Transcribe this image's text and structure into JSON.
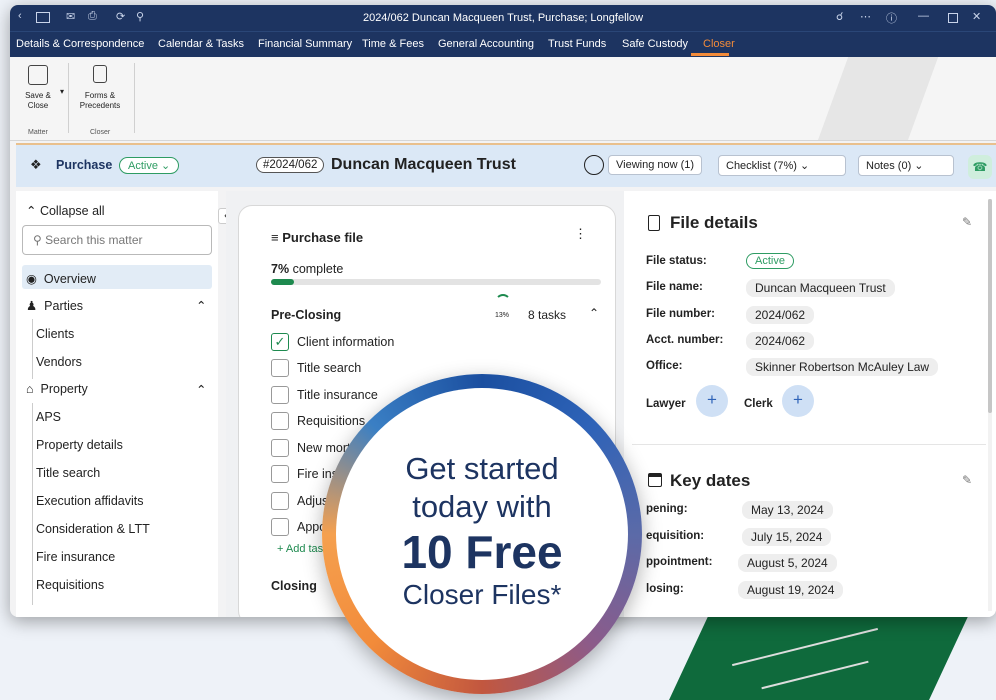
{
  "window": {
    "title": "2024/062 Duncan Macqueen Trust, Purchase; Longfellow"
  },
  "menu": [
    "Details & Correspondence",
    "Calendar & Tasks",
    "Financial Summary",
    "Time & Fees",
    "General Accounting",
    "Trust Funds",
    "Safe Custody",
    "Closer"
  ],
  "ribbon": {
    "save_close": "Save & Close",
    "forms": "Forms & Precedents",
    "sec_matter": "Matter",
    "sec_closer": "Closer"
  },
  "header": {
    "type": "Purchase",
    "status": "Active",
    "file_no": "#2024/062",
    "title": "Duncan Macqueen Trust",
    "viewing": "Viewing now (1)",
    "checklist": "Checklist (7%)",
    "notes": "Notes (0)"
  },
  "left": {
    "collapse": "Collapse all",
    "search_placeholder": "Search this matter",
    "overview": "Overview",
    "parties": "Parties",
    "clients": "Clients",
    "vendors": "Vendors",
    "property": "Property",
    "items": [
      "APS",
      "Property details",
      "Title search",
      "Execution affidavits",
      "Consideration & LTT",
      "Fire insurance",
      "Requisitions"
    ]
  },
  "purchase": {
    "title": "Purchase file",
    "progress_label": "complete",
    "progress_pct": "7%",
    "progress_value": 7,
    "pre_closing": "Pre-Closing",
    "pre_pct": "13%",
    "pre_tasks": "8 tasks",
    "tasks": [
      "Client information",
      "Title search",
      "Title insurance",
      "Requisitions",
      "New mortg",
      "Fire insu",
      "Adjusti",
      "Appoi"
    ],
    "add_task": "+ Add task",
    "closing": "Closing"
  },
  "file_details": {
    "title": "File details",
    "status_label": "File status:",
    "status": "Active",
    "name_label": "File name:",
    "name": "Duncan Macqueen Trust",
    "number_label": "File number:",
    "number": "2024/062",
    "acct_label": "Acct. number:",
    "acct": "2024/062",
    "office_label": "Office:",
    "office": "Skinner Robertson McAuley Law",
    "lawyer": "Lawyer",
    "clerk": "Clerk",
    "plus": "+"
  },
  "key_dates": {
    "title": "Key dates",
    "rows": [
      {
        "label": "pening:",
        "date": "May 13, 2024"
      },
      {
        "label": "equisition:",
        "date": "July 15, 2024"
      },
      {
        "label": "ppointment:",
        "date": "August 5, 2024"
      },
      {
        "label": "losing:",
        "date": "August 19, 2024"
      }
    ]
  },
  "promo": {
    "l1": "Get started",
    "l2": "today with",
    "l3": "10 Free",
    "l4": "Closer Files*"
  }
}
